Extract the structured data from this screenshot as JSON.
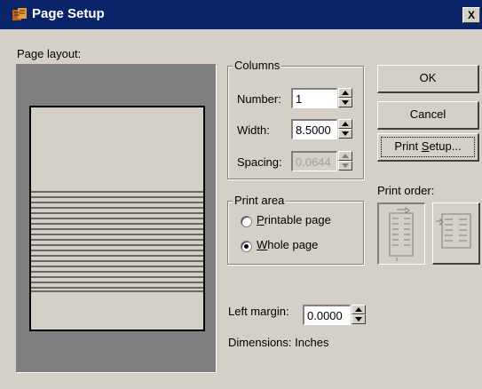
{
  "window": {
    "title": "Page Setup",
    "close_label": "X"
  },
  "layout": {
    "label": "Page layout:"
  },
  "columns": {
    "group_title": "Columns",
    "number_label": "Number:",
    "number_value": "1",
    "width_label": "Width:",
    "width_value": "8.5000",
    "spacing_label": "Spacing:",
    "spacing_value": "0.0644"
  },
  "print_area": {
    "group_title": "Print area",
    "options": [
      {
        "label_prefix": "",
        "accel": "P",
        "label_rest": "rintable page",
        "selected": false
      },
      {
        "label_prefix": "",
        "accel": "W",
        "label_rest": "hole page",
        "selected": true
      }
    ]
  },
  "margin": {
    "label": "Left margin:",
    "value": "0.0000",
    "dimensions": "Dimensions: Inches"
  },
  "buttons": {
    "ok": "OK",
    "cancel": "Cancel",
    "print_setup_prefix": "Print ",
    "print_setup_accel": "S",
    "print_setup_rest": "etup..."
  },
  "print_order": {
    "label": "Print order:",
    "selected": "down-then-across"
  },
  "colors": {
    "title_bar": "#0a246a",
    "face": "#d4d0c8",
    "preview_bg": "#808080"
  }
}
